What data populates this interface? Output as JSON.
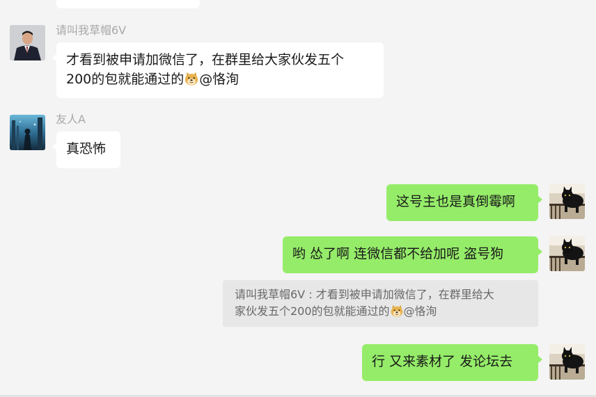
{
  "colors": {
    "chat_background": "#f4f4f4",
    "incoming_bubble": "#ffffff",
    "outgoing_bubble": "#95ec69",
    "sender_name": "#a8a8a8",
    "quote_background": "#e7e7e7"
  },
  "messages": [
    {
      "sender": "请叫我草帽6V",
      "avatar": "man-in-suit-avatar",
      "line1": "才看到被申请加微信了，在群里给大家伙发五个",
      "line2_before_emoji": "200的包就能通过的",
      "emoji": "doge-emoji",
      "line2_after_emoji": "@恪洵"
    },
    {
      "sender": "友人A",
      "avatar": "night-scene-avatar",
      "text": "真恐怖"
    },
    {
      "avatar": "black-cat-avatar",
      "text": "这号主也是真倒霉啊"
    },
    {
      "avatar": "black-cat-avatar",
      "text": "哟 怂了啊 连微信都不给加呢 盗号狗"
    },
    {
      "avatar": "black-cat-avatar",
      "text": "行 又来素材了 发论坛去"
    }
  ],
  "quote": {
    "line1": "请叫我草帽6V : 才看到被申请加微信了，在群里给大",
    "line2_before_emoji": "家伙发五个200的包就能通过的",
    "emoji": "doge-emoji",
    "line2_after_emoji": "@恪洵"
  }
}
